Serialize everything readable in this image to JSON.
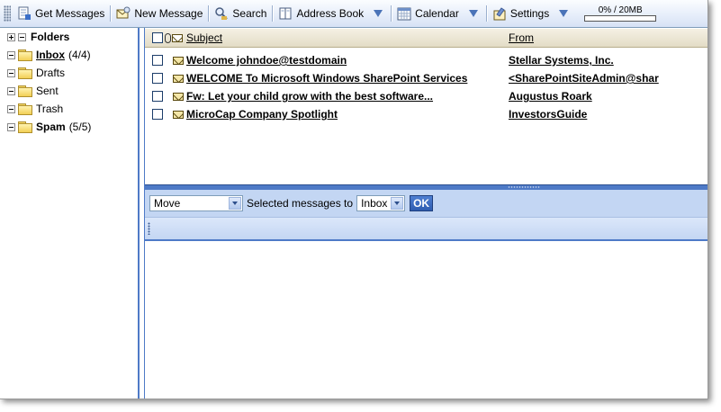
{
  "toolbar": {
    "get_messages": "Get Messages",
    "new_message": "New Message",
    "search": "Search",
    "address_book": "Address Book",
    "calendar": "Calendar",
    "settings": "Settings",
    "quota_text": "0% / 20MB",
    "quota_fraction": 0
  },
  "folders": {
    "title": "Folders",
    "items": [
      {
        "label": "Inbox",
        "count": "(4/4)"
      },
      {
        "label": "Drafts",
        "count": ""
      },
      {
        "label": "Sent",
        "count": ""
      },
      {
        "label": "Trash",
        "count": ""
      },
      {
        "label": "Spam",
        "count": "(5/5)"
      }
    ]
  },
  "list": {
    "col_subject": "Subject",
    "col_from": "From",
    "messages": [
      {
        "subject": "Welcome johndoe@testdomain",
        "from": "Stellar Systems, Inc."
      },
      {
        "subject": "WELCOME To Microsoft Windows SharePoint Services",
        "from": "<SharePointSiteAdmin@shar"
      },
      {
        "subject": "Fw: Let your child grow with the best software...",
        "from": "Augustus Roark"
      },
      {
        "subject": "MicroCap Company Spotlight",
        "from": "InvestorsGuide"
      }
    ]
  },
  "actions": {
    "action_select": "Move",
    "selected_label": "Selected messages to",
    "target_select": "Inbox",
    "ok_label": "OK"
  }
}
